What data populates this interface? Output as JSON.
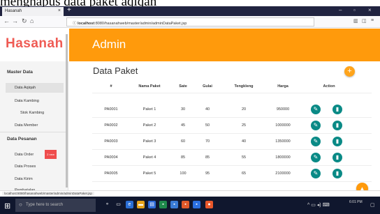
{
  "caption": "menghapus data paket aqiqah",
  "browser": {
    "tab_title": "Hasanah",
    "tab_close": "×",
    "new_tab": "+",
    "url_host": "localhost",
    "url_rest": ":8080/hasanahweb/master/admin/adminDataPaket.jsp",
    "url_icons": "··· ♥ ☆",
    "win_min": "–",
    "win_max": "▫",
    "win_close": "×"
  },
  "sidebar": {
    "logo": "Hasanah",
    "sections": [
      {
        "title": "Master Data"
      },
      {
        "title": "Data Pesanan"
      }
    ],
    "items": [
      "Data Aqiqah",
      "Data Kambing",
      "Stok Kambing",
      "Data Member",
      "Data Order",
      "Data Proses",
      "Data Kirim",
      "Pembatalan"
    ],
    "badge": "2 new"
  },
  "header": {
    "title": "Admin"
  },
  "main": {
    "title": "Data Paket",
    "add_icon": "+",
    "columns": [
      "#",
      "Nama Paket",
      "Sate",
      "Gulai",
      "Tengkleng",
      "Harga",
      "Action"
    ],
    "rows": [
      {
        "id": "PA0001",
        "nama": "Paket 1",
        "sate": "30",
        "gulai": "40",
        "tengkleng": "20",
        "harga": "950000"
      },
      {
        "id": "PA0002",
        "nama": "Paket 2",
        "sate": "45",
        "gulai": "50",
        "tengkleng": "25",
        "harga": "1000000"
      },
      {
        "id": "PA0003",
        "nama": "Paket 3",
        "sate": "60",
        "gulai": "70",
        "tengkleng": "40",
        "harga": "1350000"
      },
      {
        "id": "PA0004",
        "nama": "Paket 4",
        "sate": "85",
        "gulai": "85",
        "tengkleng": "55",
        "harga": "1800000"
      },
      {
        "id": "PA0005",
        "nama": "Paket 5",
        "sate": "100",
        "gulai": "95",
        "tengkleng": "65",
        "harga": "2100000"
      }
    ]
  },
  "statusbar": {
    "url": "localhost:8080/hasanahweb/master/admin/adminDataPaket.jsp"
  },
  "taskbar": {
    "search_placeholder": "Type here to search",
    "time": "6:01 PM"
  },
  "colors": {
    "header": "#ff9a0c",
    "logo": "#ef5b54",
    "action": "#0a8a86",
    "badge": "#ef4d4d"
  }
}
